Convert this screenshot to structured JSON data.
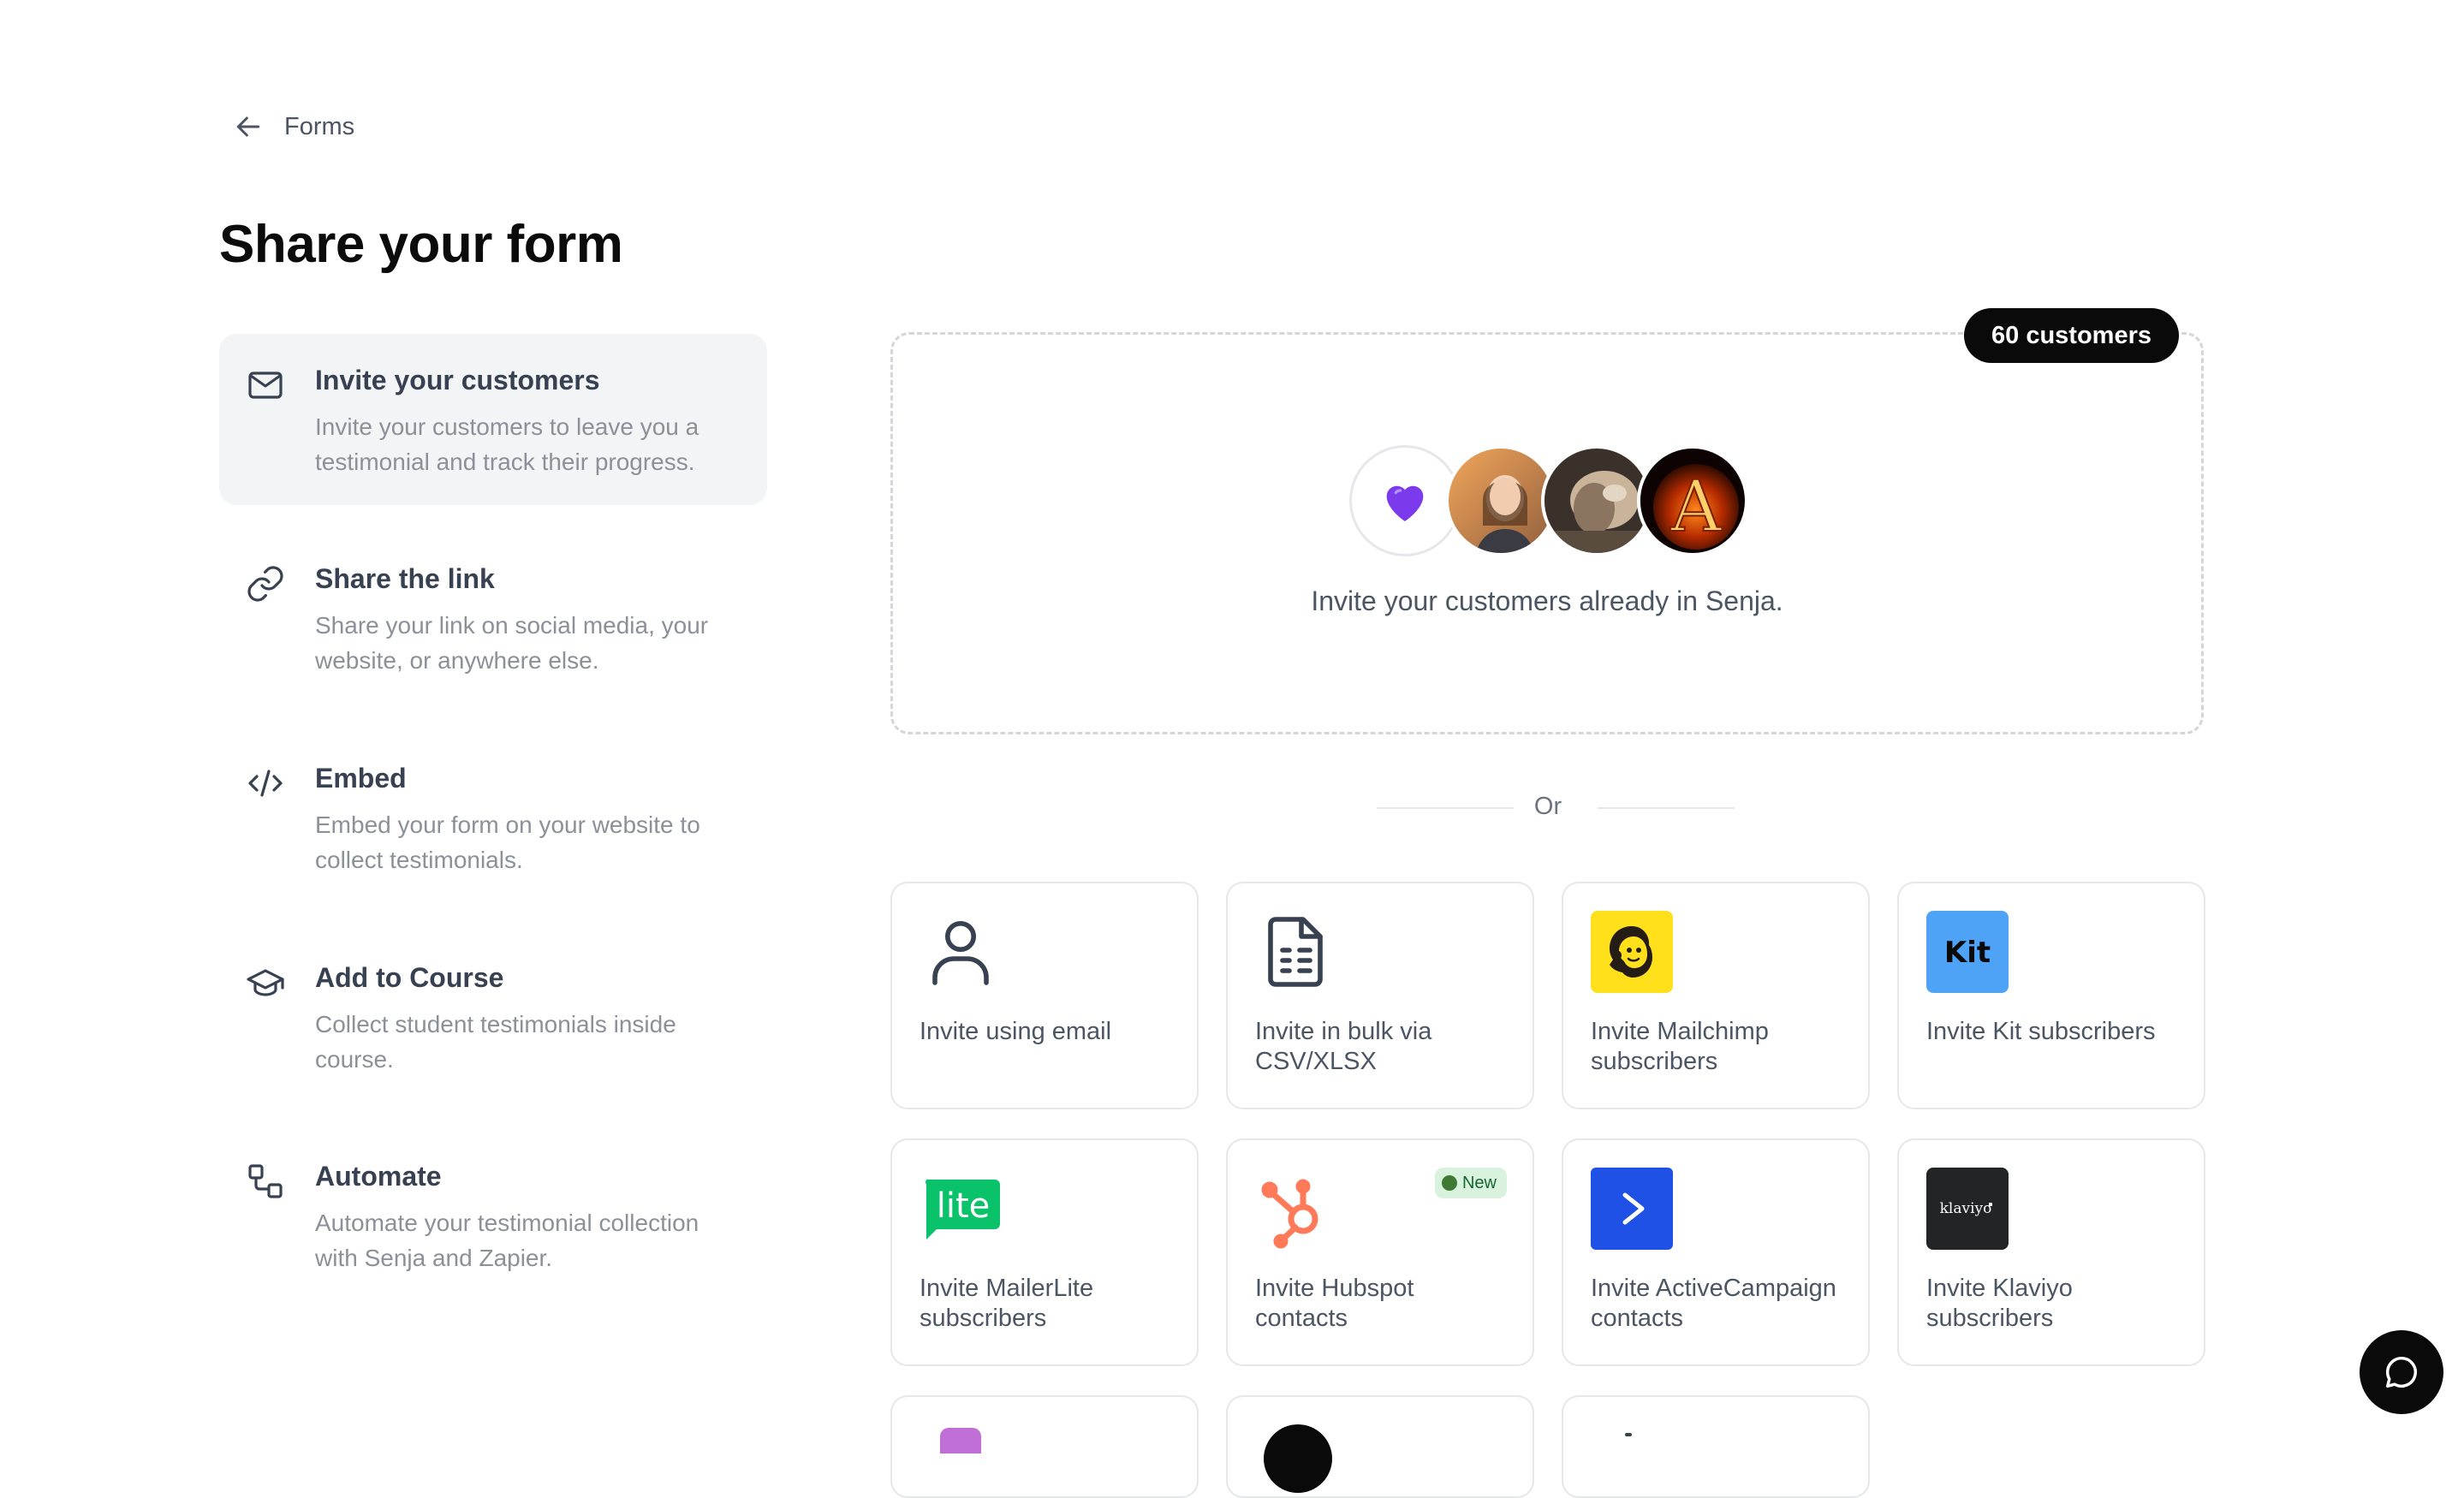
{
  "back_link": {
    "label": "Forms",
    "icon": "arrow-left-icon"
  },
  "page_title": "Share your form",
  "nav": [
    {
      "title": "Invite your customers",
      "desc": "Invite your customers to leave you a testimonial and track their progress.",
      "icon": "mail-icon",
      "active": true
    },
    {
      "title": "Share the link",
      "desc": "Share your link on social media, your website, or anywhere else.",
      "icon": "link-icon",
      "active": false
    },
    {
      "title": "Embed",
      "desc": "Embed your form on your website to collect testimonials.",
      "icon": "code-icon",
      "active": false
    },
    {
      "title": "Add to Course",
      "desc": "Collect student testimonials inside course.",
      "icon": "graduation-cap-icon",
      "active": false
    },
    {
      "title": "Automate",
      "desc": "Automate your testimonial collection with Senja and Zapier.",
      "icon": "workflow-icon",
      "active": false
    }
  ],
  "customers": {
    "badge": "60 customers",
    "text": "Invite your customers already in Senja."
  },
  "divider": {
    "label": "Or"
  },
  "cards": [
    {
      "label": "Invite using email",
      "icon": "user-icon"
    },
    {
      "label": "Invite in bulk via CSV/XLSX",
      "icon": "spreadsheet-file-icon"
    },
    {
      "label": "Invite Mailchimp subscribers",
      "icon": "mailchimp-logo-icon"
    },
    {
      "label": "Invite Kit subscribers",
      "icon": "kit-logo-icon",
      "logo_text": "Kit"
    },
    {
      "label": "Invite MailerLite subscribers",
      "icon": "mailerlite-logo-icon",
      "logo_text": "lite"
    },
    {
      "label": "Invite Hubspot contacts",
      "icon": "hubspot-logo-icon",
      "badge": "New"
    },
    {
      "label": "Invite ActiveCampaign contacts",
      "icon": "activecampaign-logo-icon"
    },
    {
      "label": "Invite Klaviyo subscribers",
      "icon": "klaviyo-logo-icon",
      "logo_text": "klaviyo"
    }
  ],
  "colors": {
    "accent_dark": "#0a0a0a",
    "kit": "#4fa3f7",
    "mailchimp": "#ffe01b",
    "mailerlite": "#09c269",
    "hubspot": "#ff7a59",
    "activecampaign": "#1f51e6",
    "klaviyo": "#232426",
    "heart": "#7c3aed"
  },
  "chat": {
    "icon": "chat-bubble-icon"
  }
}
